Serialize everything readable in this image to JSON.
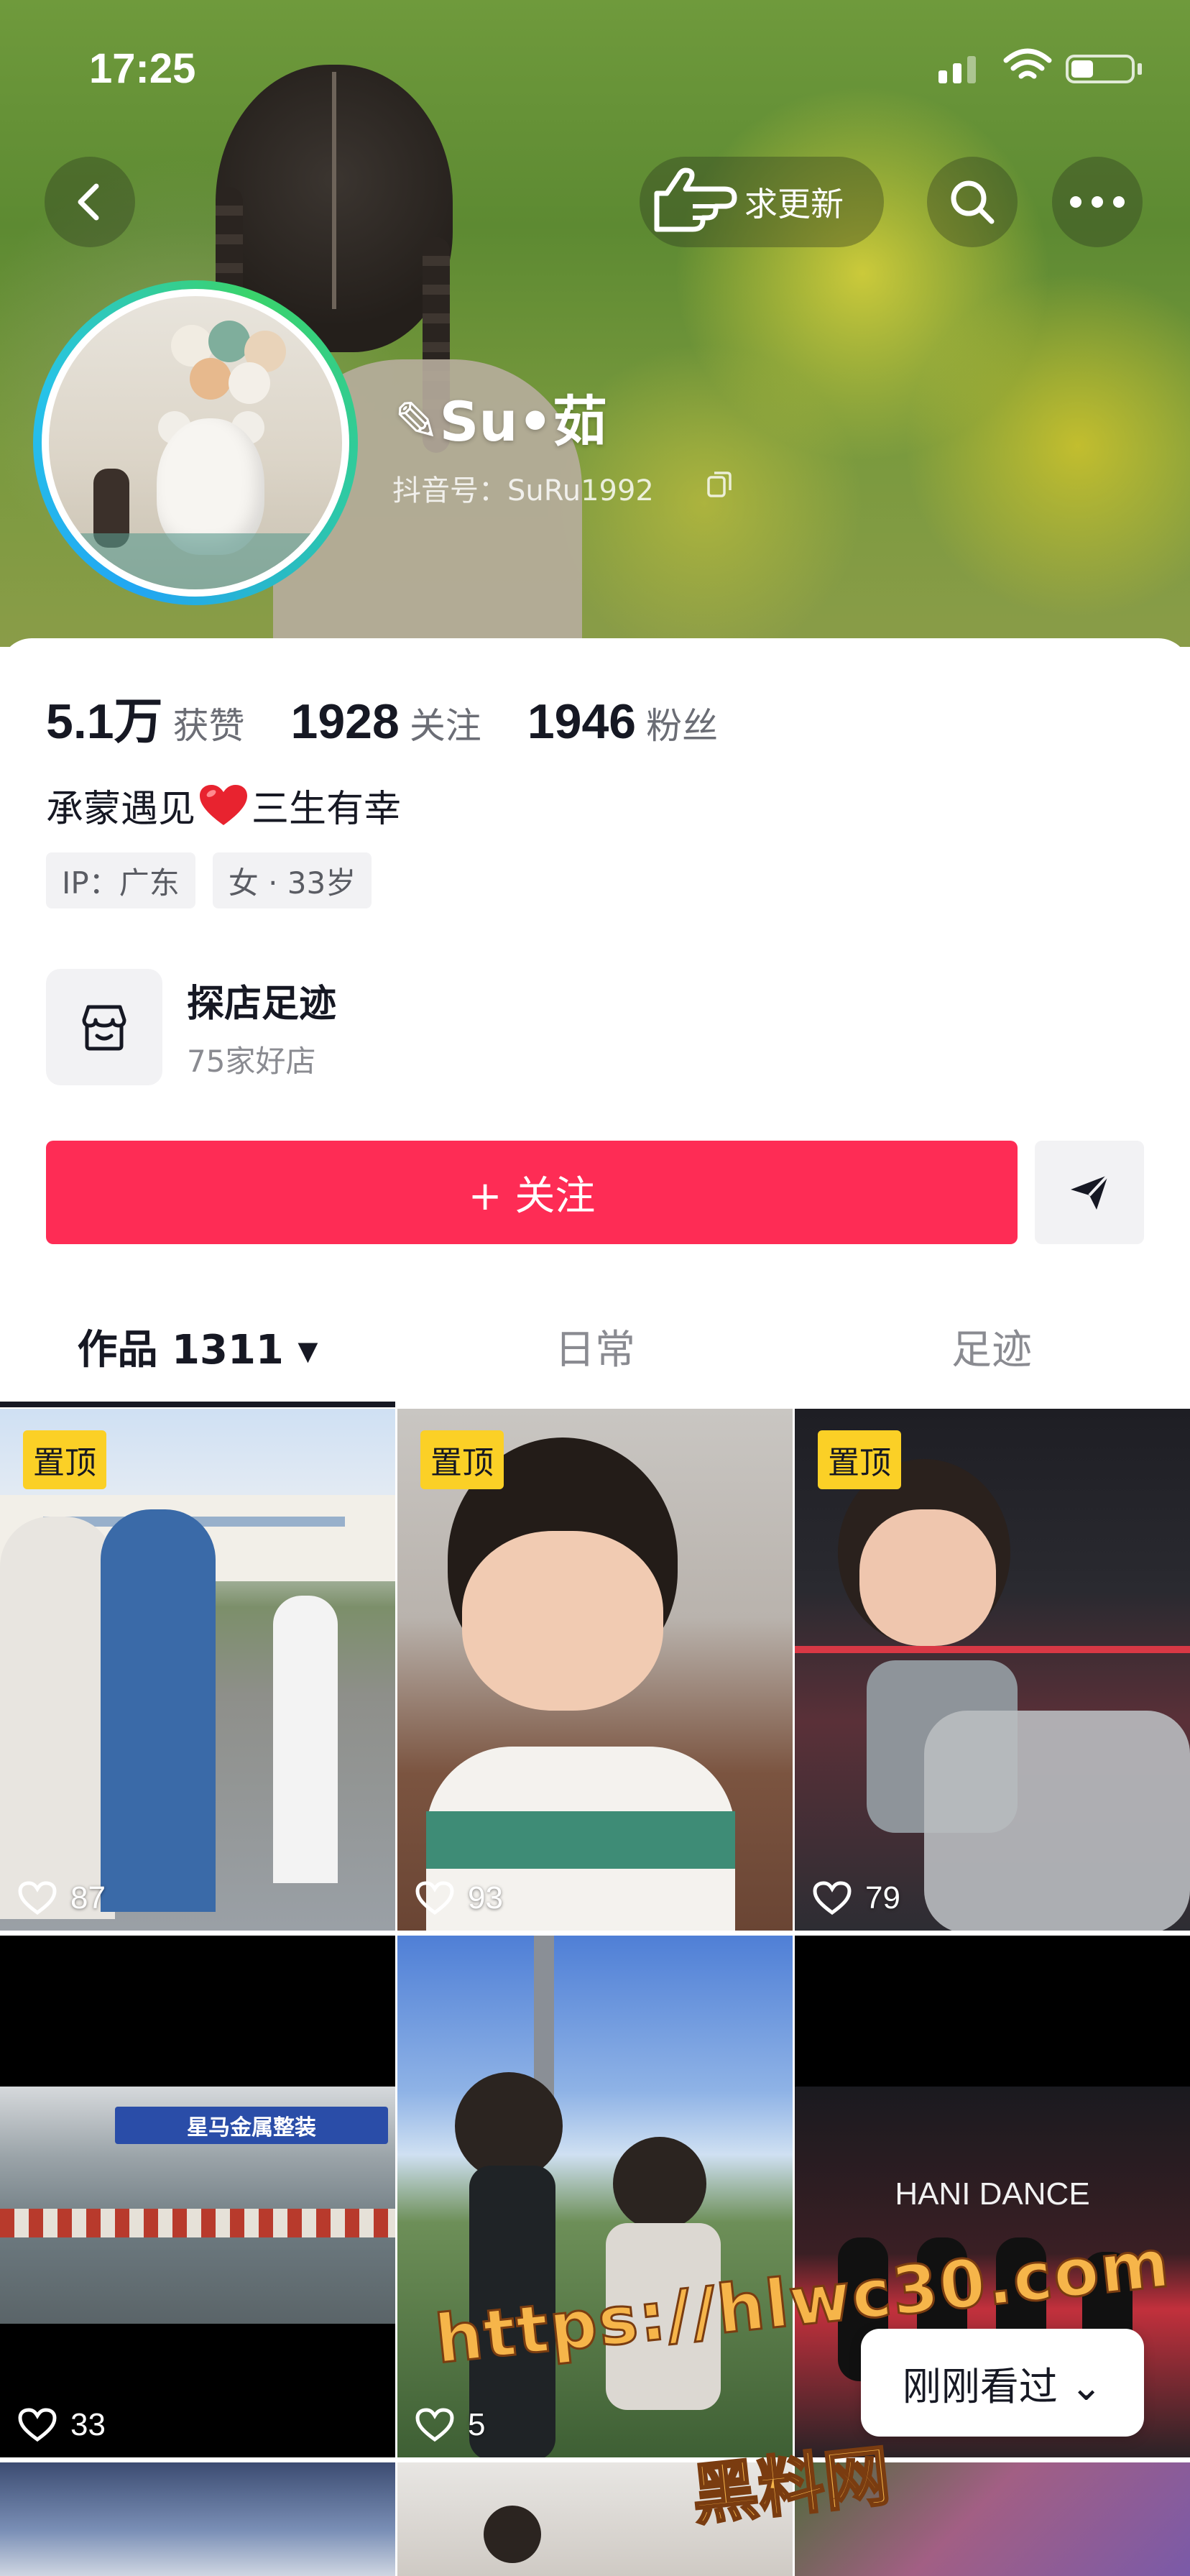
{
  "status_bar": {
    "time": "17:25"
  },
  "header": {
    "update_request_label": "求更新",
    "nickname": "✎Su•茹",
    "douyin_id": "抖音号：SuRu1992"
  },
  "stats": [
    {
      "value": "5.1万",
      "label": "获赞"
    },
    {
      "value": "1928",
      "label": "关注"
    },
    {
      "value": "1946",
      "label": "粉丝"
    }
  ],
  "bio": {
    "before": "承蒙遇见",
    "after": "三生有幸"
  },
  "tags": [
    "IP：广东",
    "女 · 33岁"
  ],
  "shop": {
    "title": "探店足迹",
    "subtitle": "75家好店"
  },
  "follow_button": "+ 关注",
  "tabs": [
    {
      "label": "作品 1311 ▾"
    },
    {
      "label": "日常"
    },
    {
      "label": "足迹"
    }
  ],
  "videos": [
    {
      "pinned": true,
      "pin_label": "置顶",
      "likes": "87"
    },
    {
      "pinned": true,
      "pin_label": "置顶",
      "likes": "93"
    },
    {
      "pinned": true,
      "pin_label": "置顶",
      "likes": "79"
    },
    {
      "pinned": false,
      "likes": "33",
      "banner_text": "星马金属整装"
    },
    {
      "pinned": false,
      "likes": "5"
    },
    {
      "pinned": false,
      "likes": "",
      "overlay_text": "HANI DANCE"
    }
  ],
  "recently_viewed": "刚刚看过 ⌄",
  "watermark": {
    "url": "https://hlwc30.com",
    "name": "黑料网"
  }
}
